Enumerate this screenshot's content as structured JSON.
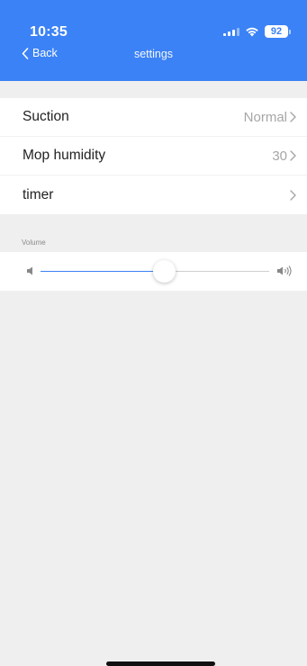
{
  "status_bar": {
    "time": "10:35",
    "battery": "92"
  },
  "nav": {
    "back_label": "Back",
    "title": "settings"
  },
  "settings": [
    {
      "label": "Suction",
      "value": "Normal"
    },
    {
      "label": "Mop humidity",
      "value": "30"
    },
    {
      "label": "timer",
      "value": ""
    }
  ],
  "volume": {
    "label": "Volume",
    "level": 0.54
  },
  "colors": {
    "accent": "#3b82f6",
    "background": "#efefef"
  }
}
